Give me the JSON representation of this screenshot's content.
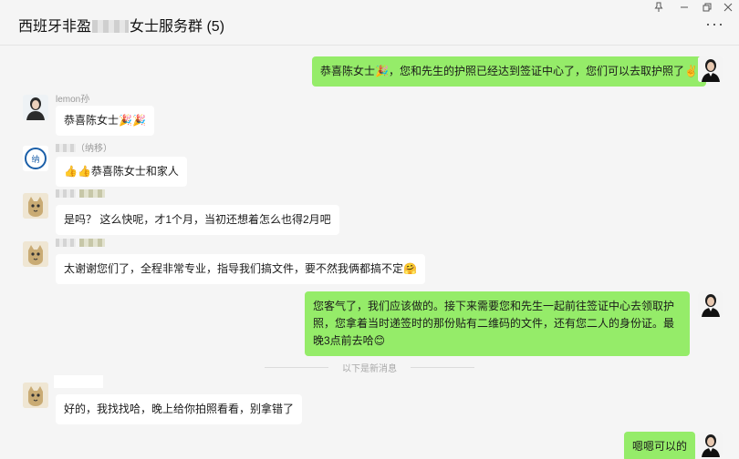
{
  "window": {
    "title_prefix": "西班牙非盈",
    "title_suffix": "女士服务群 (5)",
    "pin_icon": "pin-icon",
    "minimize_icon": "minimize-icon",
    "maximize_icon": "restore-icon",
    "close_icon": "close-icon",
    "more_icon": "more-icon"
  },
  "messages": [
    {
      "side": "out",
      "text": "恭喜陈女士🎉，您和先生的护照已经达到签证中心了，您们可以去取护照了✌️"
    },
    {
      "side": "in",
      "sender": "lemon孙",
      "text": "恭喜陈女士🎉🎉"
    },
    {
      "side": "in",
      "sender": "（纳移）",
      "text": "👍👍恭喜陈女士和家人"
    },
    {
      "side": "in",
      "sender": "",
      "text": "是吗？ 这么快呢，才1个月，当初还想着怎么也得2月吧"
    },
    {
      "side": "in",
      "sender": "",
      "text": "太谢谢您们了，全程非常专业，指导我们搞文件，要不然我俩都搞不定🤗"
    },
    {
      "side": "out",
      "text": "您客气了，我们应该做的。接下来需要您和先生一起前往签证中心去领取护照，您拿着当时递签时的那份贴有二维码的文件，还有您二人的身份证。最晚3点前去哈😊"
    },
    {
      "side": "in",
      "sender": "",
      "text": "好的，我找找哈，晚上给你拍照看看，别拿错了"
    },
    {
      "side": "out",
      "text": "嗯嗯可以的"
    }
  ],
  "divider_text": "以下是新消息",
  "colors": {
    "outgoing_bubble": "#95ec69",
    "incoming_bubble": "#ffffff",
    "background": "#f5f5f5"
  }
}
